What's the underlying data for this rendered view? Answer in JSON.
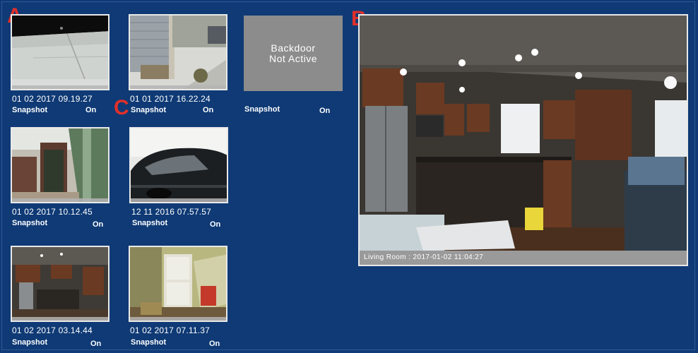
{
  "markers": {
    "a": "A",
    "b": "B",
    "c": "C"
  },
  "cameras": [
    {
      "timestamp": "01 02 2017 09.19.27",
      "snapshot": "Snapshot",
      "status": "On"
    },
    {
      "timestamp": "01 01 2017 16.22.24",
      "snapshot": "Snapshot",
      "status": "On"
    },
    {
      "timestamp": "01 02 2017 10.12.45",
      "snapshot": "Snapshot",
      "status": "On"
    },
    {
      "timestamp": "12 11 2016 07.57.57",
      "snapshot": "Snapshot",
      "status": "On"
    },
    {
      "timestamp": "01 02 2017 03.14.44",
      "snapshot": "Snapshot",
      "status": "On"
    },
    {
      "timestamp": "01 02 2017 07.11.37",
      "snapshot": "Snapshot",
      "status": "On"
    }
  ],
  "backdoor": {
    "line1": "Backdoor",
    "line2": "Not Active",
    "snapshot": "Snapshot",
    "status": "On"
  },
  "main_view": {
    "caption": "Living Room : 2017-01-02 11:04:27"
  },
  "colors": {
    "background": "#0f3a75",
    "marker": "#e0302a",
    "inactive_tile": "#8c8c8c"
  }
}
